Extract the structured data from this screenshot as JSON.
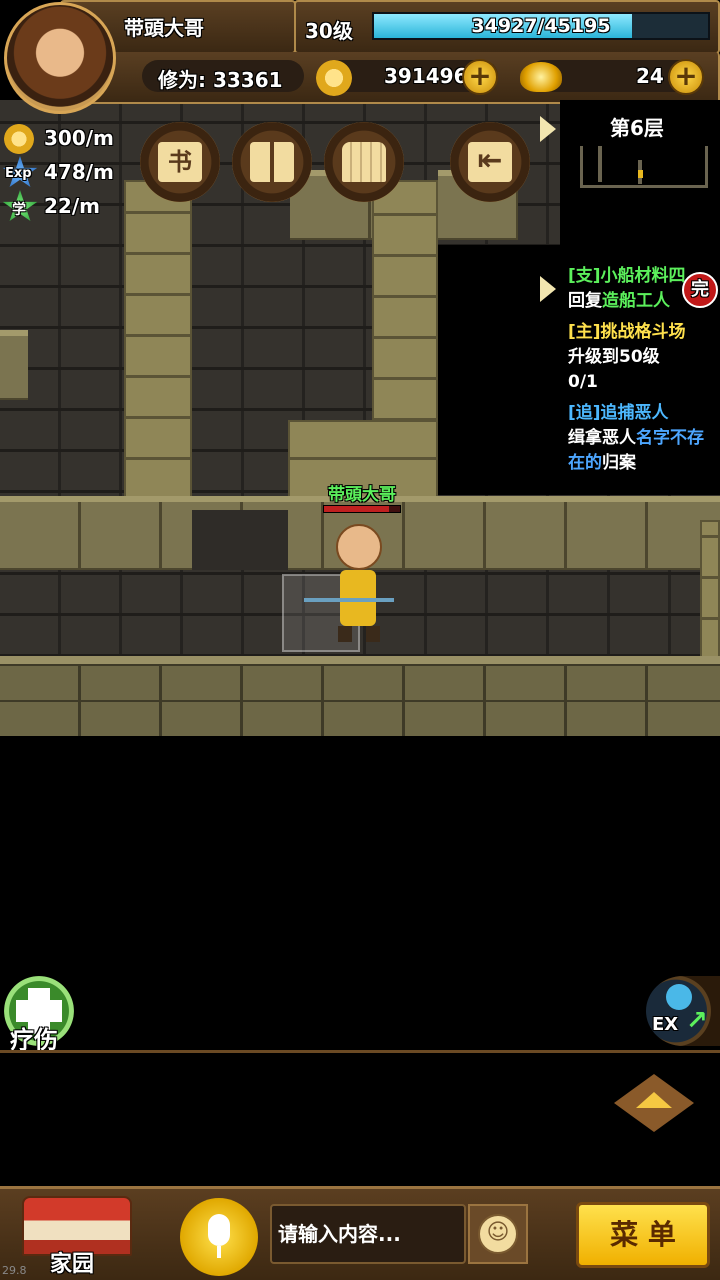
{
  "player": {
    "name": "带頭大哥",
    "level": "30级",
    "exp_text": "34927/45195",
    "exp_fraction": 0.773,
    "cultivation_label": "修为: 33361",
    "coins": "391496",
    "ingots": "24"
  },
  "rates": {
    "gold": "300/m",
    "exp_icon_text": "Exp",
    "exp": "478/m",
    "study_icon_text": "学",
    "study": "22/m"
  },
  "toolbar": {
    "book_icon_text": "书"
  },
  "minimap": {
    "floor": "第6层"
  },
  "quests": [
    {
      "tag": "[支]小船材料四",
      "desc_plain": "回复",
      "desc_highlight": "造船工人",
      "badge": "完"
    },
    {
      "tag": "[主]挑战格斗场",
      "desc": "升级到50级",
      "progress": "0/1"
    },
    {
      "tag": "[追]追捕恶人",
      "desc_a": "缉拿恶人",
      "desc_highlight": "名字不存",
      "desc_b": "在的",
      "desc_c": "归案"
    }
  ],
  "character": {
    "nameplate": "带頭大哥"
  },
  "buttons": {
    "heal": "疗伤",
    "ex": "EX",
    "home": "家园",
    "menu": "菜 单"
  },
  "chat": {
    "placeholder": "请输入内容..."
  },
  "fps": "29.8",
  "colors": {
    "quest_side": "#5cf05c",
    "quest_main": "#ffe14d",
    "quest_chase": "#4db8ff",
    "highlight_green": "#5cf05c",
    "highlight_blue": "#4da6ff"
  }
}
